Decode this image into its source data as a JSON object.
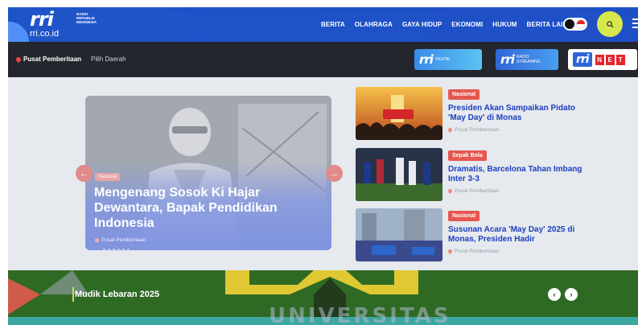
{
  "header": {
    "logo_mark": "rri",
    "logo_sub": "RADIO REPUBLIK INDONESIA",
    "logo_domain": "rri.co.id",
    "nav": [
      "BERITA",
      "OLAHRAGA",
      "GAYA HIDUP",
      "EKONOMI",
      "HUKUM",
      "BERITA LAIN"
    ]
  },
  "subbar": {
    "location": "Pusat Pemberitaan",
    "region_link": "Pilih Daerah",
    "badges": {
      "digital_logo": "rri",
      "digital_sub": "DIGITAL",
      "stream_logo": "rri",
      "stream_sub": "RADIO STREAMING",
      "net_logo": "rri",
      "net_letters": [
        "N",
        "E",
        "T"
      ]
    }
  },
  "slider": {
    "tag": "Nasional",
    "title": "Mengenang Sosok Ki Hajar Dewantara, Bapak Pendidikan Indonesia",
    "location": "Pusat Pemberitaan",
    "dots_count": 6
  },
  "news": [
    {
      "category": "Nasional",
      "title": "Presiden Akan Sampaikan Pidato 'May Day' di Monas",
      "location": "Pusat Pemberitaan"
    },
    {
      "category": "Sepak Bola",
      "title": "Dramatis, Barcelona Tahan Imbang Inter 3-3",
      "location": "Pusat Pemberitaan"
    },
    {
      "category": "Nasional",
      "title": "Susunan Acara 'May Day' 2025 di Monas, Presiden Hadir",
      "location": "Pusat Pemberitaan"
    }
  ],
  "banner": {
    "label": "Mudik Lebaran 2025"
  },
  "watermark": "UNIVERSITAS",
  "colors": {
    "header_blue": "#1f54c8",
    "subbar_dark": "#23262d",
    "category_red": "#e5574f",
    "headline_blue": "#1d3fbf",
    "search_yellow": "#d7e84c",
    "banner_green": "#2f6a25"
  }
}
